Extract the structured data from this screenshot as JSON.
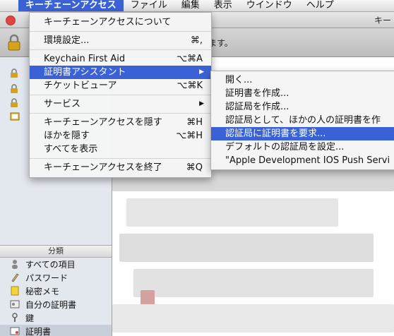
{
  "menubar": {
    "apple_glyph": "",
    "items": [
      {
        "label": "キーチェーンアクセス",
        "active": true
      },
      {
        "label": "ファイル"
      },
      {
        "label": "編集"
      },
      {
        "label": "表示"
      },
      {
        "label": "ウインドウ"
      },
      {
        "label": "ヘルプ"
      }
    ]
  },
  "window": {
    "title": "キー",
    "toolbar_text": "ます。"
  },
  "app_menu": {
    "items": [
      {
        "label": "キーチェーンアクセスについて"
      },
      {
        "label": "環境設定...",
        "shortcut": "⌘,"
      },
      {
        "label": "Keychain First Aid",
        "shortcut": "⌥⌘A"
      },
      {
        "label": "証明書アシスタント",
        "arrow": "▶",
        "highlighted": true
      },
      {
        "label": "チケットビューア",
        "shortcut": "⌥⌘K"
      },
      {
        "label": "サービス",
        "arrow": "▶"
      },
      {
        "label": "キーチェーンアクセスを隠す",
        "shortcut": "⌘H"
      },
      {
        "label": "ほかを隠す",
        "shortcut": "⌥⌘H"
      },
      {
        "label": "すべてを表示"
      },
      {
        "label": "キーチェーンアクセスを終了",
        "shortcut": "⌘Q"
      }
    ]
  },
  "cert_submenu": {
    "items": [
      {
        "label": "開く..."
      },
      {
        "label": "証明書を作成..."
      },
      {
        "label": "認証局を作成..."
      },
      {
        "label": "認証局として、ほかの人の証明書を作"
      },
      {
        "label": "認証局に証明書を要求...",
        "highlighted": true
      },
      {
        "label": "デフォルトの認証局を設定..."
      },
      {
        "label": "\"Apple Development IOS Push Servi"
      }
    ]
  },
  "sidebar": {
    "section_header": "分類",
    "categories": [
      {
        "label": "すべての項目",
        "icon": "person-icon"
      },
      {
        "label": "パスワード",
        "icon": "pencil-icon"
      },
      {
        "label": "秘密メモ",
        "icon": "note-icon"
      },
      {
        "label": "自分の証明書",
        "icon": "id-card-icon"
      },
      {
        "label": "鍵",
        "icon": "key-icon"
      },
      {
        "label": "証明書",
        "icon": "certificate-icon",
        "selected": true
      }
    ]
  },
  "colors": {
    "highlight": "#3a62d6",
    "menubar_bg": "#e6e6e6"
  }
}
